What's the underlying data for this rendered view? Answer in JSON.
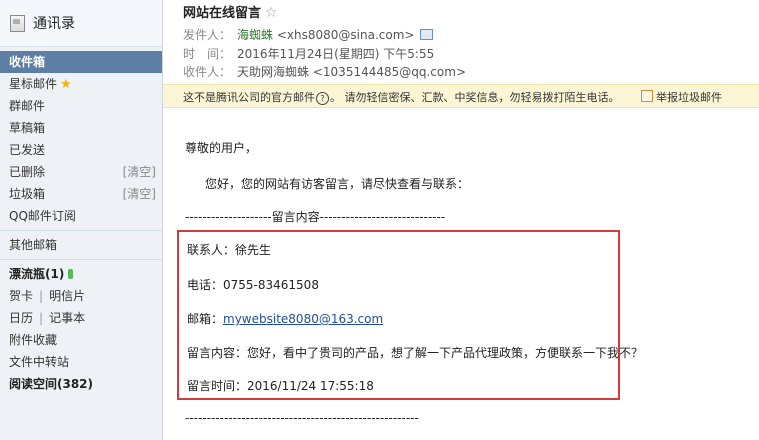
{
  "sidebar": {
    "contacts": "通讯录",
    "items": {
      "inbox": "收件箱",
      "starred": "星标邮件",
      "group": "群邮件",
      "drafts": "草稿箱",
      "sent": "已发送",
      "deleted": "已删除",
      "deleted_clear": "[清空]",
      "spam": "垃圾箱",
      "spam_clear": "[清空]",
      "qq_subscribe": "QQ邮件订阅",
      "other_mailbox": "其他邮箱",
      "drift_bottle": "漂流瓶(1)",
      "greeting_card": "贺卡",
      "postcard": "明信片",
      "calendar": "日历",
      "notepad": "记事本",
      "attachments": "附件收藏",
      "file_transfer": "文件中转站",
      "reading_space": "阅读空间(382)"
    }
  },
  "email": {
    "subject": "网站在线留言",
    "subject_star": "☆",
    "from_label": "发件人：",
    "from_name": "海蜘蛛",
    "from_addr": "<xhs8080@sina.com>",
    "time_label": "时　间：",
    "time_value": "2016年11月24日(星期四) 下午5:55",
    "to_label": "收件人：",
    "to_name": "天助网海蜘蛛",
    "to_addr": "<1035144485@qq.com>",
    "warning_pre": "这不是腾讯公司的官方邮件",
    "warning_q": "?",
    "warning_post": "。 请勿轻信密保、汇款、中奖信息，勿轻易拨打陌生电话。",
    "report": "举报垃圾邮件",
    "greeting": "尊敬的用户，",
    "intro": "您好，您的网站有访客留言，请尽快查看与联系：",
    "divider_top": "--------------------留言内容-----------------------------",
    "contact": "联系人：徐先生",
    "phone": "电话：0755-83461508",
    "email_label": "邮箱：",
    "email_value": "mywebsite8080@163.com",
    "message": "留言内容：您好，看中了贵司的产品，想了解一下产品代理政策，方便联系一下我不？",
    "msg_time": "留言时间：2016/11/24 17:55:18",
    "divider_bottom": "------------------------------------------------------"
  }
}
